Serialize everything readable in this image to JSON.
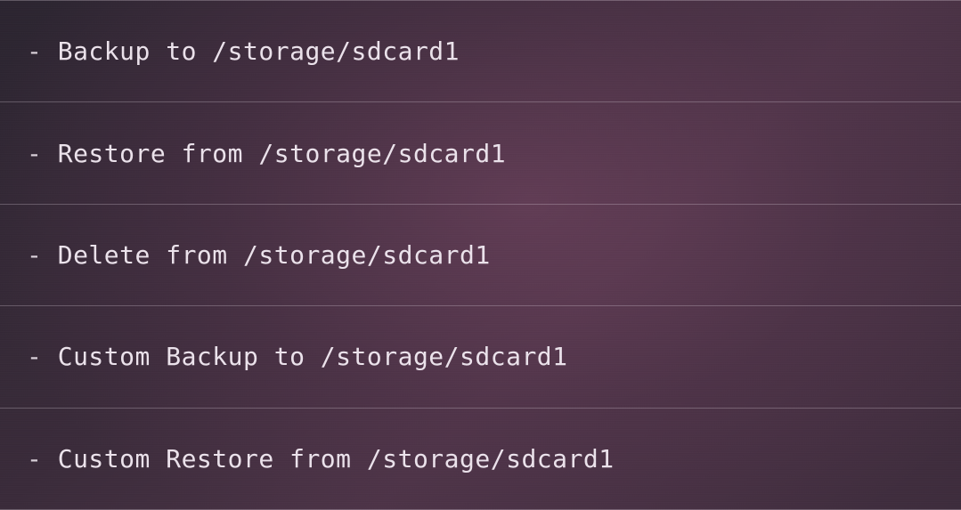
{
  "menu": {
    "items": [
      {
        "label": "Backup to /storage/sdcard1"
      },
      {
        "label": "Restore from /storage/sdcard1"
      },
      {
        "label": "Delete from /storage/sdcard1"
      },
      {
        "label": "Custom Backup to /storage/sdcard1"
      },
      {
        "label": "Custom Restore from /storage/sdcard1"
      }
    ],
    "bullet": "- "
  }
}
